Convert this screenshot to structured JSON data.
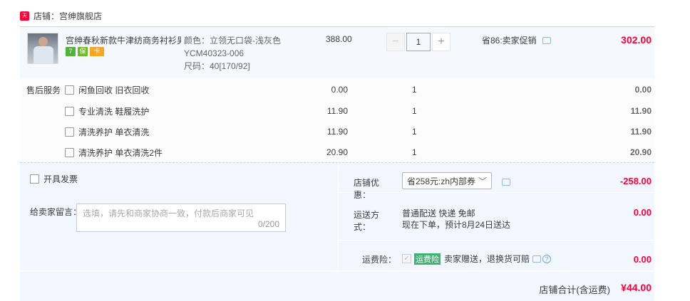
{
  "shop": {
    "badge": "天猫",
    "label": "店铺：宫绅旗舰店"
  },
  "product": {
    "title": "宫绅春秋新款牛津纺商务衬衫男...",
    "sku_color": "颜色：立领无口袋-浅灰色YCM40323-006",
    "sku_size": "尺码：40[170/92]",
    "price": "388.00",
    "quantity": "1",
    "minus": "−",
    "plus": "+",
    "promo": "省86:卖家促销",
    "subtotal": "302.00",
    "badges": [
      "7",
      "保",
      "卡"
    ]
  },
  "services": {
    "label": "售后服务",
    "items": [
      {
        "name": "闲鱼回收 旧衣回收",
        "price": "0.00",
        "qty": "1",
        "total": "0.00"
      },
      {
        "name": "专业清洗 鞋履洗护",
        "price": "11.90",
        "qty": "1",
        "total": "11.90"
      },
      {
        "name": "清洗养护 单衣清洗",
        "price": "11.90",
        "qty": "1",
        "total": "11.90"
      },
      {
        "name": "清洗养护 单衣清洗2件",
        "price": "20.90",
        "qty": "1",
        "total": "20.90"
      }
    ]
  },
  "invoice": {
    "label": "开具发票"
  },
  "note": {
    "label": "给卖家留言：",
    "placeholder": "选填，请先和商家协商一致，付款后商家可见",
    "count": "0/200"
  },
  "discount": {
    "label": "店铺优惠：",
    "selected": "省258元:zh内部券",
    "value": "-258.00"
  },
  "shipping": {
    "label": "运送方式：",
    "method": "普通配送 快递 免邮",
    "eta": "现在下单，预计8月24日送达",
    "value": "0.00"
  },
  "insurance": {
    "label": "运费险：",
    "tag": "运费险",
    "text": "卖家赠送，退换货可赔",
    "value": "0.00"
  },
  "total": {
    "label": "店铺合计(含运费)",
    "value": "¥44.00"
  }
}
